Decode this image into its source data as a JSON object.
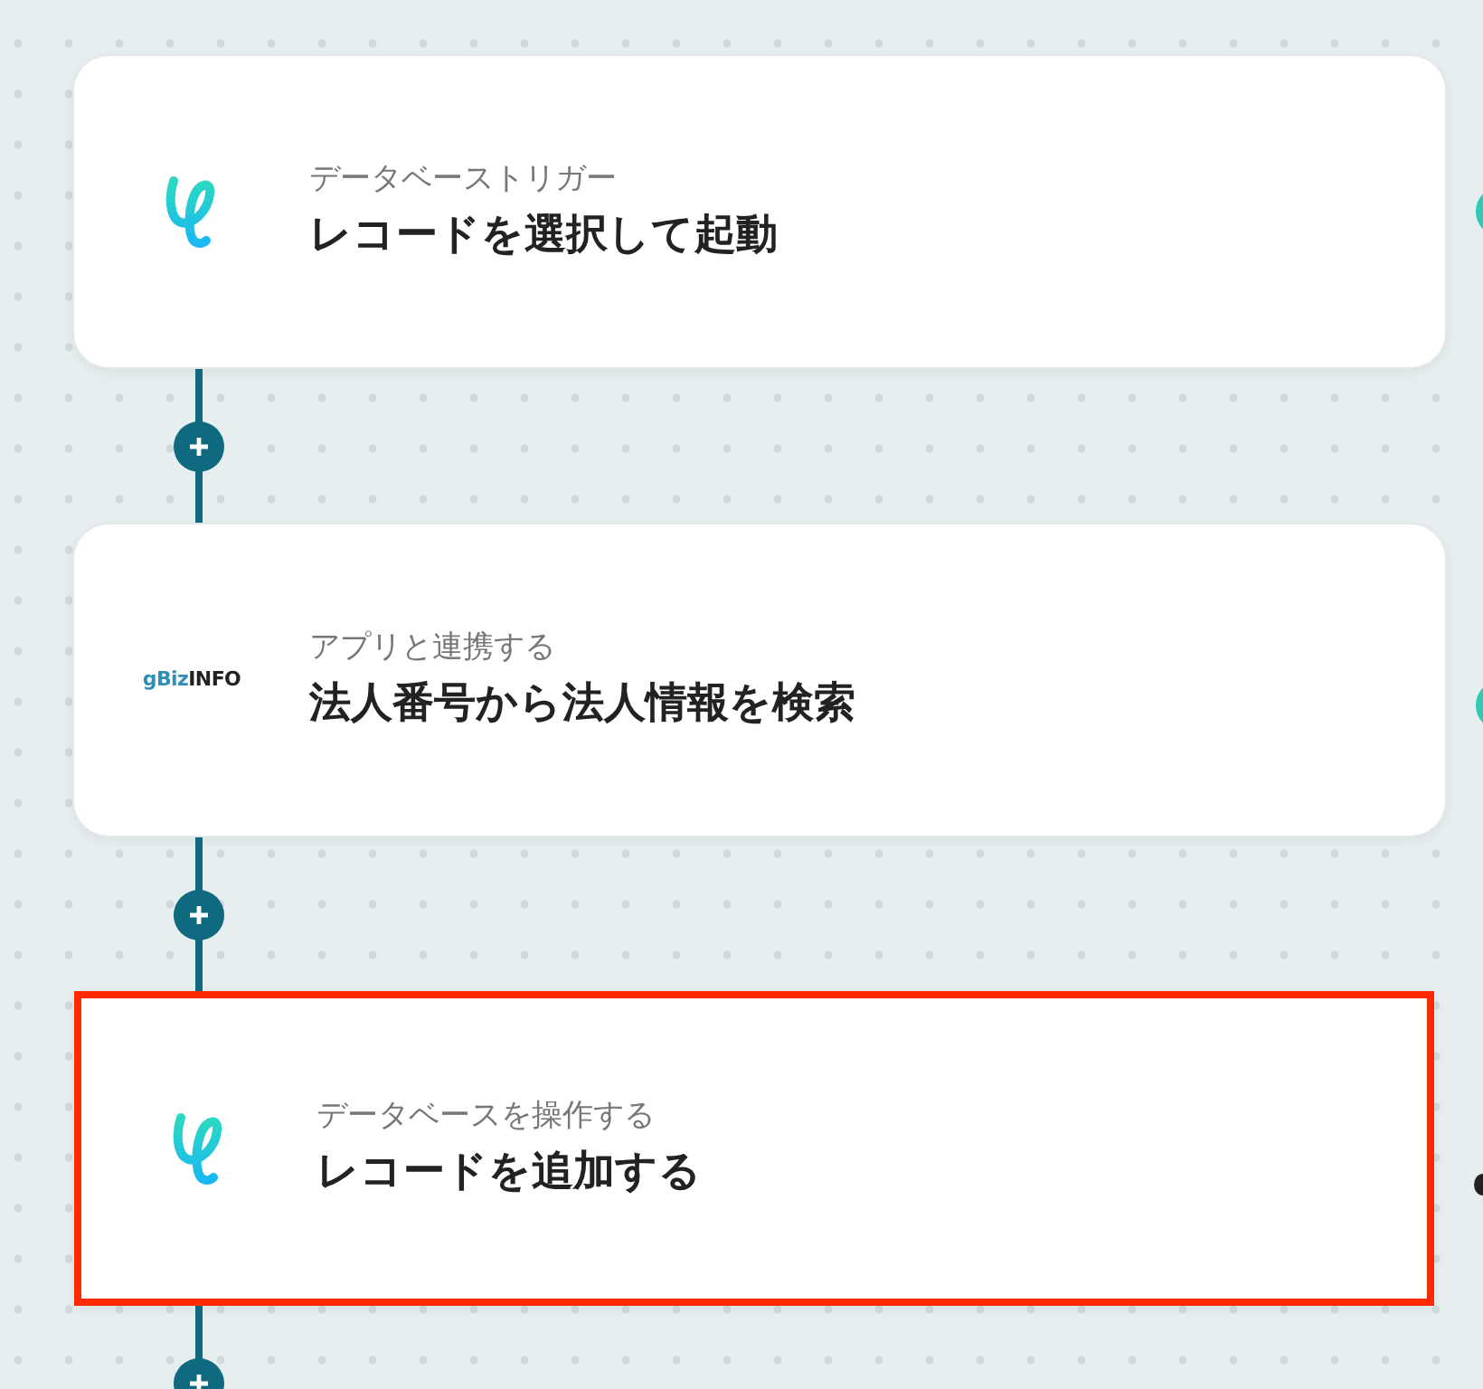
{
  "steps": [
    {
      "kind": "database",
      "category": "データベーストリガー",
      "title": "レコードを選択して起動",
      "highlighted": false
    },
    {
      "kind": "app",
      "logo": [
        "gBiz",
        "INFO"
      ],
      "category": "アプリと連携する",
      "title": "法人番号から法人情報を検索",
      "highlighted": false
    },
    {
      "kind": "database",
      "category": "データベースを操作する",
      "title": "レコードを追加する",
      "highlighted": true
    }
  ]
}
